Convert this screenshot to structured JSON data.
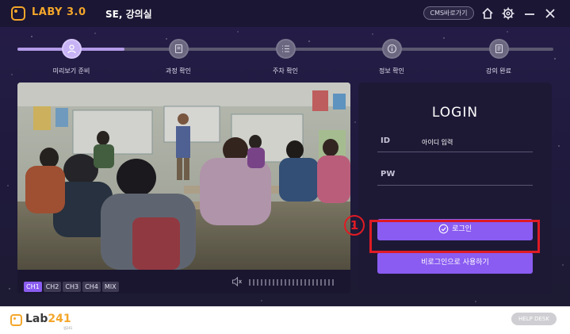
{
  "app": {
    "title": "LABY 3.0",
    "classroom": "SE, 강의실",
    "cms_button": "CMS바로가기",
    "accent_color": "#f4a62a"
  },
  "window_icons": [
    "home-icon",
    "gear-icon",
    "minimize-icon",
    "close-icon"
  ],
  "steps": [
    {
      "label": "미리보기 준비",
      "icon": "user-icon",
      "active": true
    },
    {
      "label": "과정 확인",
      "icon": "book-icon",
      "active": false
    },
    {
      "label": "주차 확인",
      "icon": "list-icon",
      "active": false
    },
    {
      "label": "정보 확인",
      "icon": "info-icon",
      "active": false
    },
    {
      "label": "강의 완료",
      "icon": "document-icon",
      "active": false
    }
  ],
  "channels": [
    {
      "label": "CH1",
      "active": true
    },
    {
      "label": "CH2",
      "active": false
    },
    {
      "label": "CH3",
      "active": false
    },
    {
      "label": "CH4",
      "active": false
    },
    {
      "label": "MIX",
      "active": false
    }
  ],
  "login": {
    "title": "LOGIN",
    "id_label": "ID",
    "id_placeholder": "아이디 입력",
    "pw_label": "PW",
    "pw_value": "",
    "login_button": "로그인",
    "guest_button": "비로그인으로 사용하기",
    "button_color": "#8a5cf1"
  },
  "annotation": {
    "marker": "1",
    "color": "#e01b24"
  },
  "footer": {
    "brand_prefix": "Lab",
    "brand_number": "241",
    "brand_sub": "랩241",
    "help_desk": "HELP DESK"
  }
}
